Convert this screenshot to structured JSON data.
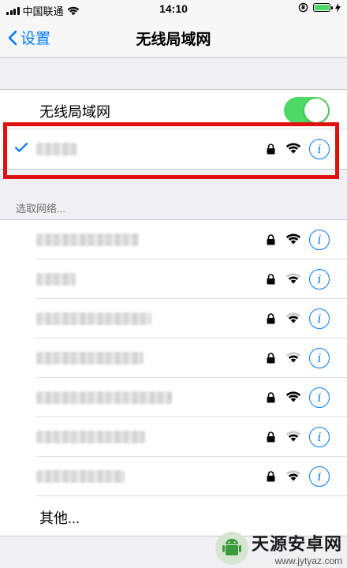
{
  "status_bar": {
    "carrier": "中国联通",
    "time": "14:10"
  },
  "nav": {
    "back_label": "设置",
    "title": "无线局域网"
  },
  "wifi_toggle": {
    "label": "无线局域网",
    "enabled": true
  },
  "connected_network": {
    "name_hidden": true,
    "secured": true,
    "signal": "full"
  },
  "networks_section": {
    "header": "选取网络...",
    "networks": [
      {
        "secured": true,
        "signal": "full"
      },
      {
        "secured": true,
        "signal": "medium"
      },
      {
        "secured": true,
        "signal": "medium"
      },
      {
        "secured": true,
        "signal": "medium"
      },
      {
        "secured": true,
        "signal": "full"
      },
      {
        "secured": true,
        "signal": "medium"
      },
      {
        "secured": true,
        "signal": "medium"
      }
    ],
    "other_label": "其他..."
  },
  "watermark": {
    "title": "天源安卓网",
    "url": "www.jytyaz.com"
  },
  "colors": {
    "accent": "#007aff",
    "toggle_on": "#4cd964",
    "highlight": "#e01010"
  }
}
